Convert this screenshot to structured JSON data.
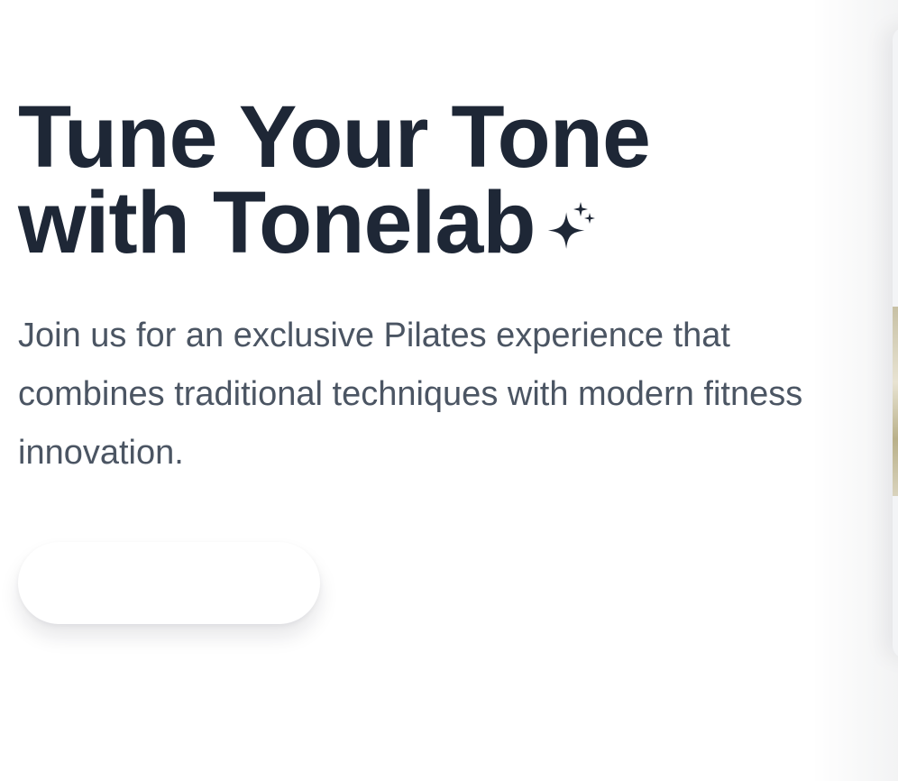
{
  "hero": {
    "title_line1": "Tune Your Tone",
    "title_line2": "with Tonelab",
    "title_icon": "sparkle-icon",
    "description": "Join us for an exclusive Pilates experience that combines traditional techniques with modern fitness innovation.",
    "cta_label": ""
  },
  "colors": {
    "heading": "#1e2736",
    "body_text": "#4b5563",
    "background": "#ffffff",
    "button_bg": "#ffffff"
  }
}
